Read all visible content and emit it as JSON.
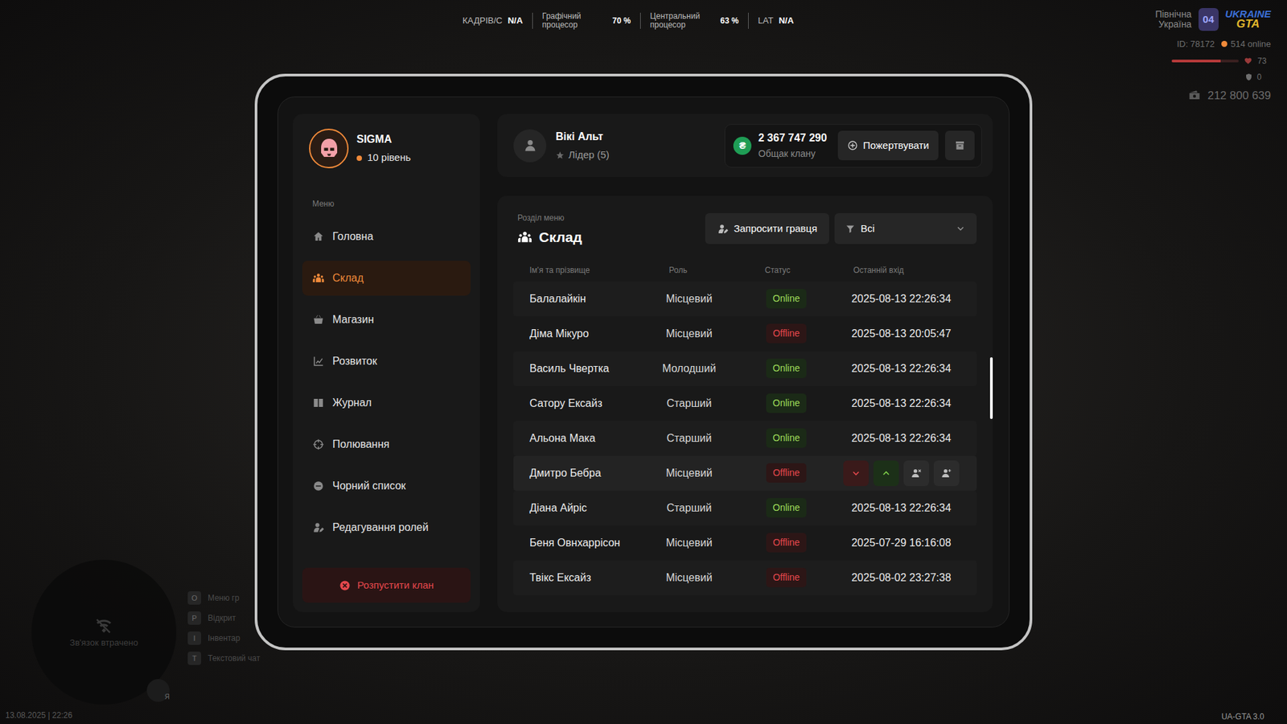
{
  "hud": {
    "fps_label": "КАДРІВ/С",
    "fps_value": "N/A",
    "gpu_label": "Графічний процесор",
    "gpu_value": "70 %",
    "cpu_label": "Центральний процесор",
    "cpu_value": "63 %",
    "lat_label": "LAT",
    "lat_value": "N/A"
  },
  "server": {
    "region": "Північна Україна",
    "number": "04",
    "logo_top": "UKRAINE",
    "logo_bottom": "GTA",
    "id": "ID: 78172",
    "online": "514 online",
    "health": "73",
    "health_level": 0.73,
    "armor": "0",
    "money": "212 800 639"
  },
  "minimap": {
    "text": "Зв'язок втрачено",
    "mic_label": "Я"
  },
  "keybinds": [
    {
      "key": "O",
      "label": "Меню гр"
    },
    {
      "key": "P",
      "label": "Відкрит"
    },
    {
      "key": "I",
      "label": "Інвентар"
    },
    {
      "key": "T",
      "label": "Текстовий чат"
    }
  ],
  "datetime": "13.08.2025 | 22:26",
  "version": "UA-GTA 3.0",
  "clan": {
    "name": "SIGMA",
    "level": "10 рівень"
  },
  "sidebar": {
    "heading": "Меню",
    "items": [
      {
        "label": "Головна",
        "selected": false
      },
      {
        "label": "Склад",
        "selected": true
      },
      {
        "label": "Магазин",
        "selected": false
      },
      {
        "label": "Розвиток",
        "selected": false
      },
      {
        "label": "Журнал",
        "selected": false
      },
      {
        "label": "Полювання",
        "selected": false
      },
      {
        "label": "Чорний список",
        "selected": false
      },
      {
        "label": "Редагування ролей",
        "selected": false
      }
    ],
    "dissolve": "Розпустити клан"
  },
  "player": {
    "name": "Вікі Альт",
    "rank": "Лідер (5)"
  },
  "treasury": {
    "symbol": "₴",
    "amount": "2 367 747 290",
    "label": "Общак клану",
    "donate": "Пожертвувати"
  },
  "section": {
    "caption": "Розділ меню",
    "title": "Склад",
    "invite": "Запросити гравця",
    "filter": "Всі"
  },
  "table": {
    "columns": [
      "Ім'я та прізвище",
      "Роль",
      "Статус",
      "Останній вхід"
    ],
    "scroll_level": 0.2,
    "rows": [
      {
        "name": "Балалайкін",
        "role": "Місцевий",
        "status": "Online",
        "online": true,
        "kind": "time",
        "last_login": "2025-08-13 22:26:34",
        "hovered": false
      },
      {
        "name": "Діма Мікуро",
        "role": "Місцевий",
        "status": "Offline",
        "online": false,
        "kind": "time",
        "last_login": "2025-08-13 20:05:47",
        "hovered": false
      },
      {
        "name": "Василь Чвертка",
        "role": "Молодший",
        "status": "Online",
        "online": true,
        "kind": "time",
        "last_login": "2025-08-13 22:26:34",
        "hovered": false
      },
      {
        "name": "Сатору Ексайз",
        "role": "Старший",
        "status": "Online",
        "online": true,
        "kind": "time",
        "last_login": "2025-08-13 22:26:34",
        "hovered": false
      },
      {
        "name": "Альона Мака",
        "role": "Старший",
        "status": "Online",
        "online": true,
        "kind": "time",
        "last_login": "2025-08-13 22:26:34",
        "hovered": false
      },
      {
        "name": "Дмитро Бебра",
        "role": "Місцевий",
        "status": "Offline",
        "online": false,
        "kind": "actions",
        "hovered": true
      },
      {
        "name": "Діана Айріс",
        "role": "Старший",
        "status": "Online",
        "online": true,
        "kind": "time",
        "last_login": "2025-08-13 22:26:34",
        "hovered": false
      },
      {
        "name": "Беня Овнхаррісон",
        "role": "Місцевий",
        "status": "Offline",
        "online": false,
        "kind": "time",
        "last_login": "2025-07-29 16:16:08",
        "hovered": false
      },
      {
        "name": "Твікс Ексайз",
        "role": "Місцевий",
        "status": "Offline",
        "online": false,
        "kind": "time",
        "last_login": "2025-08-02 23:27:38",
        "hovered": false
      }
    ]
  }
}
